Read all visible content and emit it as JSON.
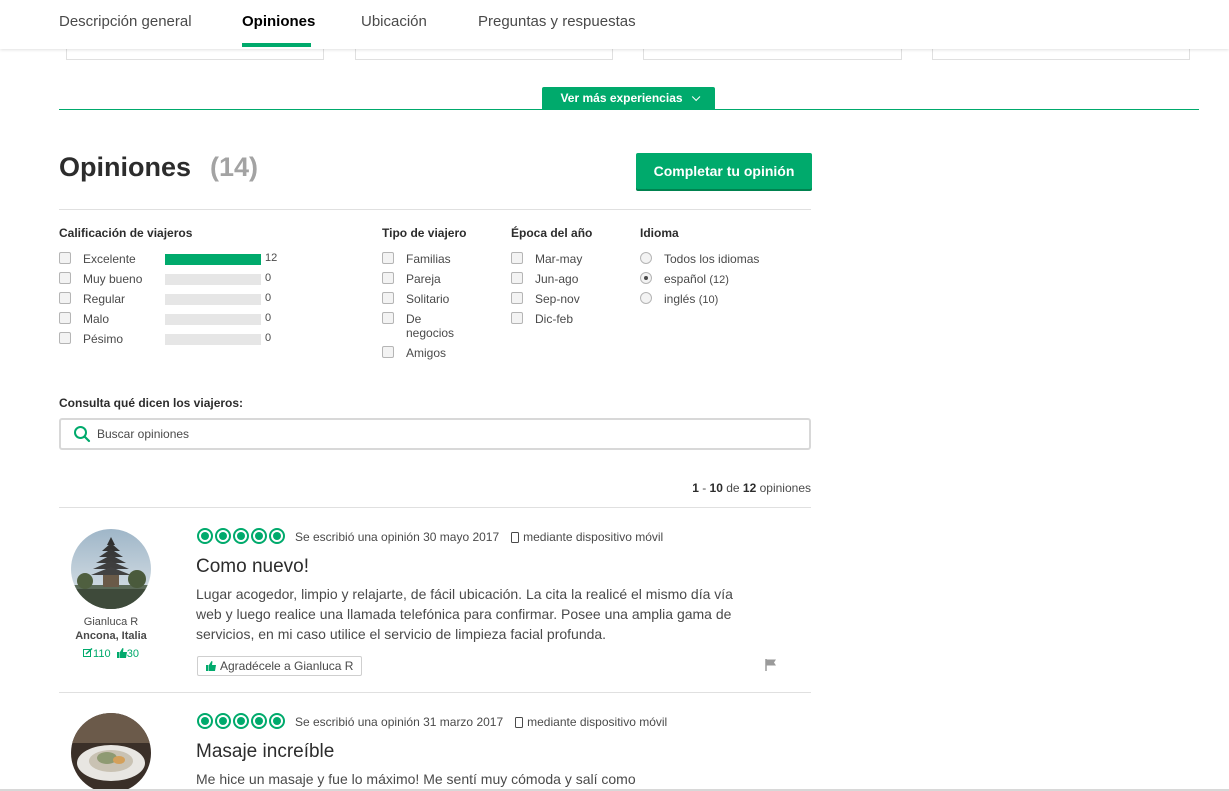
{
  "tabs": [
    {
      "label": "Descripción general"
    },
    {
      "label": "Opiniones"
    },
    {
      "label": "Ubicación"
    },
    {
      "label": "Preguntas y respuestas"
    }
  ],
  "see_more": {
    "label": "Ver más experiencias"
  },
  "reviews_header": {
    "title": "Opiniones",
    "count": "(14)",
    "cta_label": "Completar tu opinión"
  },
  "filters": {
    "rating": {
      "heading": "Calificación de viajeros",
      "items": [
        {
          "label": "Excelente",
          "count": "12",
          "fill": 1.0
        },
        {
          "label": "Muy bueno",
          "count": "0",
          "fill": 0
        },
        {
          "label": "Regular",
          "count": "0",
          "fill": 0
        },
        {
          "label": "Malo",
          "count": "0",
          "fill": 0
        },
        {
          "label": "Pésimo",
          "count": "0",
          "fill": 0
        }
      ]
    },
    "traveler_type": {
      "heading": "Tipo de viajero",
      "items": [
        {
          "label": "Familias"
        },
        {
          "label": "Pareja"
        },
        {
          "label": "Solitario"
        },
        {
          "label": "De negocios"
        },
        {
          "label": "Amigos"
        }
      ]
    },
    "season": {
      "heading": "Época del año",
      "items": [
        {
          "label": "Mar-may"
        },
        {
          "label": "Jun-ago"
        },
        {
          "label": "Sep-nov"
        },
        {
          "label": "Dic-feb"
        }
      ]
    },
    "language": {
      "heading": "Idioma",
      "items": [
        {
          "label": "Todos los idiomas",
          "count": "",
          "selected": false
        },
        {
          "label": "español",
          "count": "(12)",
          "selected": true
        },
        {
          "label": "inglés",
          "count": "(10)",
          "selected": false
        }
      ]
    }
  },
  "search": {
    "label": "Consulta qué dicen los viajeros:",
    "placeholder": "Buscar opiniones"
  },
  "paging": {
    "from": "1",
    "dash": " - ",
    "to": "10",
    "of": " de ",
    "total": "12",
    "suffix": " opiniones"
  },
  "reviews": [
    {
      "reviewer_name": "Gianluca R",
      "reviewer_location": "Ancona, Italia",
      "contributions": "110",
      "helpful_votes": "30",
      "rating": 5,
      "written": "Se escribió una opinión 30 mayo 2017",
      "device": "mediante dispositivo móvil",
      "title": "Como nuevo!",
      "body": "Lugar acogedor, limpio y relajarte, de fácil ubicación. La cita la realicé el mismo día vía web y luego realice una llamada telefónica para confirmar. Posee una amplia gama de servicios, en mi caso utilice el servicio de limpieza facial profunda.",
      "thank_label": "Agradécele a Gianluca R"
    },
    {
      "rating": 5,
      "written": "Se escribió una opinión 31 marzo 2017",
      "device": "mediante dispositivo móvil",
      "title": "Masaje increíble",
      "body": "Me hice un masaje y fue lo máximo! Me sentí muy cómoda y salí como"
    }
  ],
  "colors": {
    "accent": "#00aa6c",
    "text": "#4a4a4a",
    "heading": "#2c2c2c",
    "muted": "#a3a3a3"
  }
}
